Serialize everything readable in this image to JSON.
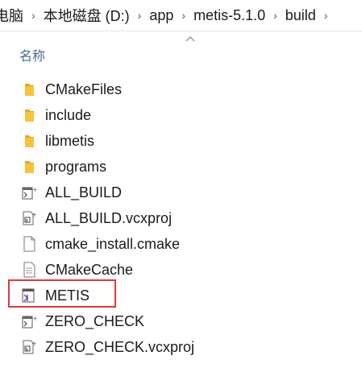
{
  "breadcrumb": [
    "电脑",
    "本地磁盘 (D:)",
    "app",
    "metis-5.1.0",
    "build"
  ],
  "header": {
    "name_label": "名称"
  },
  "files": [
    {
      "name": "CMakeFiles",
      "icon": "folder-icon"
    },
    {
      "name": "include",
      "icon": "folder-icon"
    },
    {
      "name": "libmetis",
      "icon": "folder-icon"
    },
    {
      "name": "programs",
      "icon": "folder-icon"
    },
    {
      "name": "ALL_BUILD",
      "icon": "vs-project-icon"
    },
    {
      "name": "ALL_BUILD.vcxproj",
      "icon": "vcxproj-file-icon"
    },
    {
      "name": "cmake_install.cmake",
      "icon": "generic-file-icon"
    },
    {
      "name": "CMakeCache",
      "icon": "text-file-icon"
    },
    {
      "name": "METIS",
      "icon": "visual-studio-solution-icon"
    },
    {
      "name": "ZERO_CHECK",
      "icon": "vs-project-icon"
    },
    {
      "name": "ZERO_CHECK.vcxproj",
      "icon": "vcxproj-file-icon"
    }
  ],
  "highlight_color": "#e0383b",
  "folder_color": "#f8c33a"
}
